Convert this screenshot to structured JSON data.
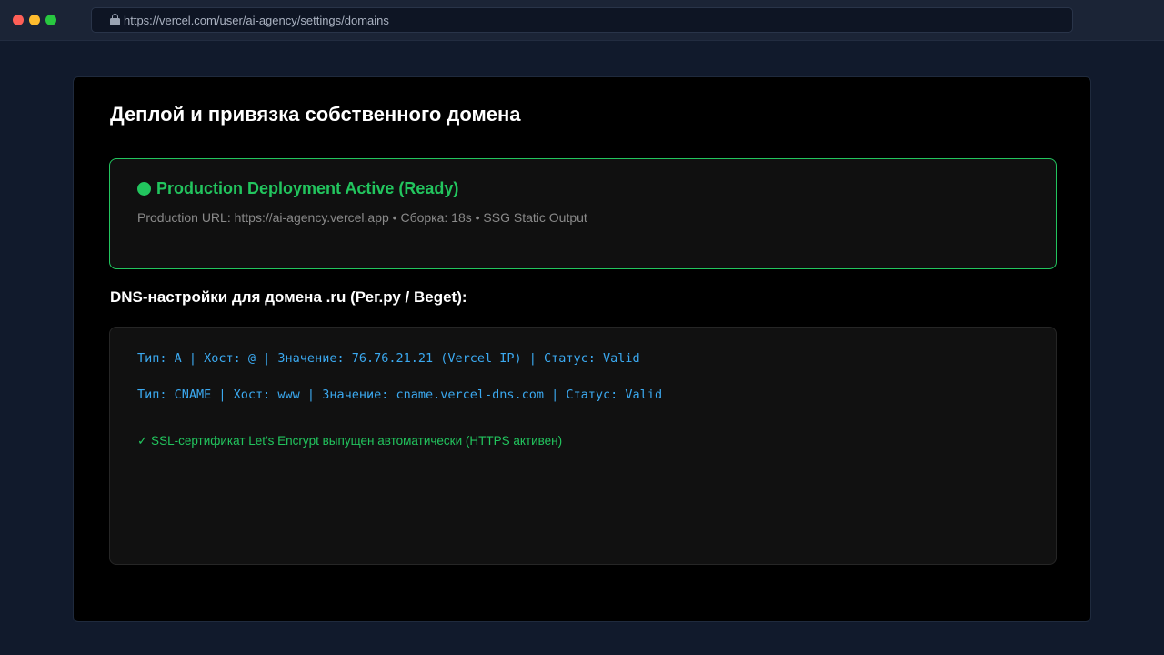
{
  "browser": {
    "url": "https://vercel.com/user/ai-agency/settings/domains"
  },
  "page": {
    "title": "Деплой и привязка собственного домена"
  },
  "deployment": {
    "status_title": "Production Deployment Active (Ready)",
    "meta": "Production URL: https://ai-agency.vercel.app • Сборка: 18s • SSG Static Output",
    "accent_color": "#22c55e"
  },
  "dns": {
    "section_title": "DNS-настройки для домена .ru (Рег.ру / Beget):",
    "records": [
      "Тип: A | Хост: @ | Значение: 76.76.21.21 (Vercel IP) | Статус: Valid",
      "Тип: CNAME | Хост: www | Значение: cname.vercel-dns.com | Статус: Valid"
    ],
    "ssl_note": "✓ SSL-сертификат Let's Encrypt выпущен автоматически (HTTPS активен)",
    "record_color": "#3ba9f0"
  }
}
